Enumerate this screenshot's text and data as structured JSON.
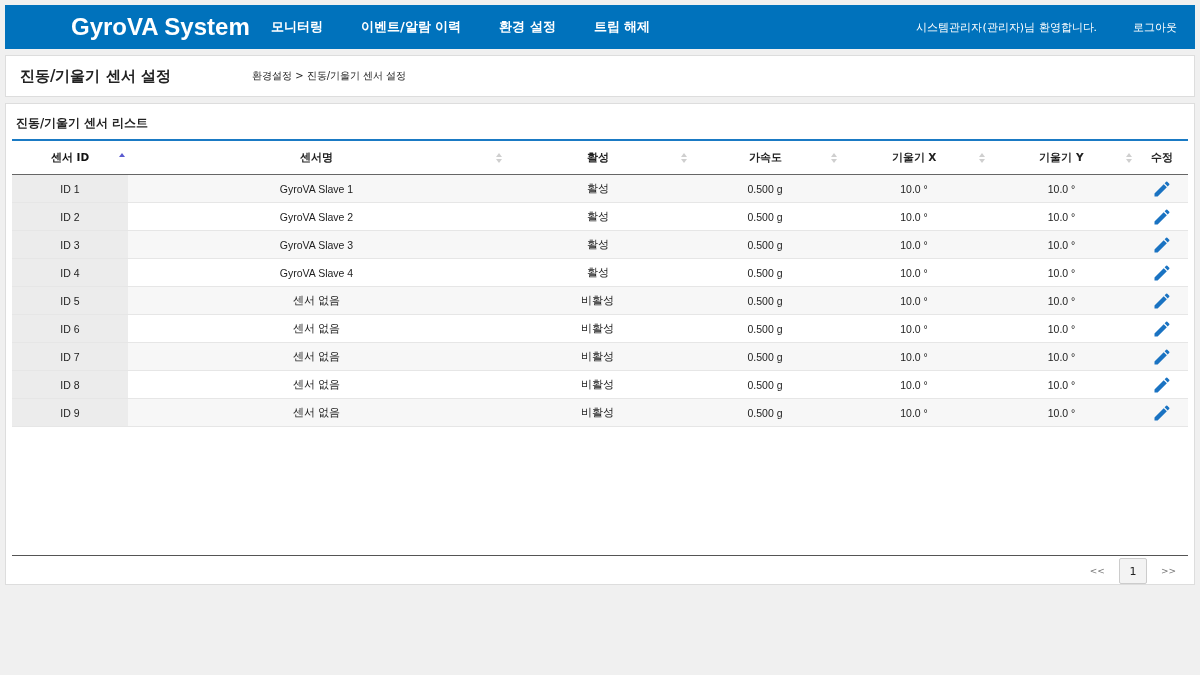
{
  "header": {
    "logo": "GyroVA System",
    "nav": [
      {
        "label": "모니터링"
      },
      {
        "label": "이벤트/알람 이력"
      },
      {
        "label": "환경 설정"
      },
      {
        "label": "트립 해제"
      }
    ],
    "welcome": "시스템관리자(관리자)님 환영합니다.",
    "logout": "로그아웃"
  },
  "page_title": "진동/기울기 센서 설정",
  "breadcrumb": "환경설정 > 진동/기울기 센서 설정",
  "panel_title": "진동/기울기 센서 리스트",
  "table": {
    "columns": [
      {
        "label": "센서 ID",
        "sortable": true,
        "sorted": true
      },
      {
        "label": "센서명",
        "sortable": true,
        "sorted": false
      },
      {
        "label": "활성",
        "sortable": true,
        "sorted": false
      },
      {
        "label": "가속도",
        "sortable": true,
        "sorted": false
      },
      {
        "label": "기울기 X",
        "sortable": true,
        "sorted": false
      },
      {
        "label": "기울기 Y",
        "sortable": true,
        "sorted": false
      },
      {
        "label": "수정",
        "sortable": false,
        "sorted": false
      }
    ],
    "rows": [
      {
        "id": "ID 1",
        "name": "GyroVA Slave 1",
        "active": "활성",
        "accel": "0.500 g",
        "tilt_x": "10.0 °",
        "tilt_y": "10.0 °"
      },
      {
        "id": "ID 2",
        "name": "GyroVA Slave 2",
        "active": "활성",
        "accel": "0.500 g",
        "tilt_x": "10.0 °",
        "tilt_y": "10.0 °"
      },
      {
        "id": "ID 3",
        "name": "GyroVA Slave 3",
        "active": "활성",
        "accel": "0.500 g",
        "tilt_x": "10.0 °",
        "tilt_y": "10.0 °"
      },
      {
        "id": "ID 4",
        "name": "GyroVA Slave 4",
        "active": "활성",
        "accel": "0.500 g",
        "tilt_x": "10.0 °",
        "tilt_y": "10.0 °"
      },
      {
        "id": "ID 5",
        "name": "센서 없음",
        "active": "비활성",
        "accel": "0.500 g",
        "tilt_x": "10.0 °",
        "tilt_y": "10.0 °"
      },
      {
        "id": "ID 6",
        "name": "센서 없음",
        "active": "비활성",
        "accel": "0.500 g",
        "tilt_x": "10.0 °",
        "tilt_y": "10.0 °"
      },
      {
        "id": "ID 7",
        "name": "센서 없음",
        "active": "비활성",
        "accel": "0.500 g",
        "tilt_x": "10.0 °",
        "tilt_y": "10.0 °"
      },
      {
        "id": "ID 8",
        "name": "센서 없음",
        "active": "비활성",
        "accel": "0.500 g",
        "tilt_x": "10.0 °",
        "tilt_y": "10.0 °"
      },
      {
        "id": "ID 9",
        "name": "센서 없음",
        "active": "비활성",
        "accel": "0.500 g",
        "tilt_x": "10.0 °",
        "tilt_y": "10.0 °"
      }
    ]
  },
  "pagination": {
    "first": "<<",
    "pages": [
      {
        "label": "1",
        "selected": true
      }
    ],
    "last": ">>"
  }
}
